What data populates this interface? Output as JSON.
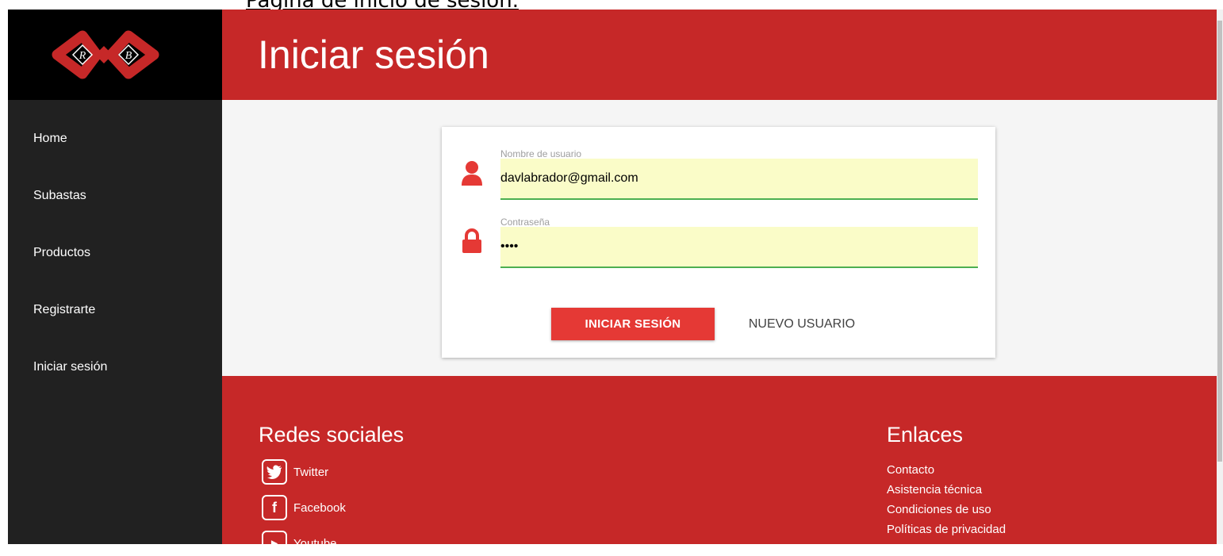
{
  "caption": "Página de inicio de sesión.",
  "header": {
    "title": "Iniciar sesión"
  },
  "logo": {
    "letters": [
      "R",
      "B"
    ]
  },
  "sidebar": {
    "items": [
      {
        "label": "Home"
      },
      {
        "label": "Subastas"
      },
      {
        "label": "Productos"
      },
      {
        "label": "Registrarte"
      },
      {
        "label": "Iniciar sesión"
      }
    ]
  },
  "form": {
    "username": {
      "label": "Nombre de usuario",
      "value": "davlabrador@gmail.com",
      "icon": "user-icon"
    },
    "password": {
      "label": "Contraseña",
      "value": "••••",
      "icon": "lock-icon"
    },
    "login_button": "INICIAR SESIÓN",
    "new_user_button": "NUEVO USUARIO"
  },
  "footer": {
    "social_title": "Redes sociales",
    "social": [
      {
        "label": "Twitter",
        "icon": "twitter-icon"
      },
      {
        "label": "Facebook",
        "icon": "facebook-icon"
      },
      {
        "label": "Youtube",
        "icon": "youtube-icon"
      }
    ],
    "links_title": "Enlaces",
    "links": [
      {
        "label": "Contacto"
      },
      {
        "label": "Asistencia técnica"
      },
      {
        "label": "Condiciones de uso"
      },
      {
        "label": "Políticas de privacidad"
      }
    ]
  },
  "colors": {
    "primary": "#c62828",
    "button": "#e53935",
    "sidebar": "#212121",
    "input_bg": "#fafcc8",
    "input_border": "#4caf50"
  }
}
